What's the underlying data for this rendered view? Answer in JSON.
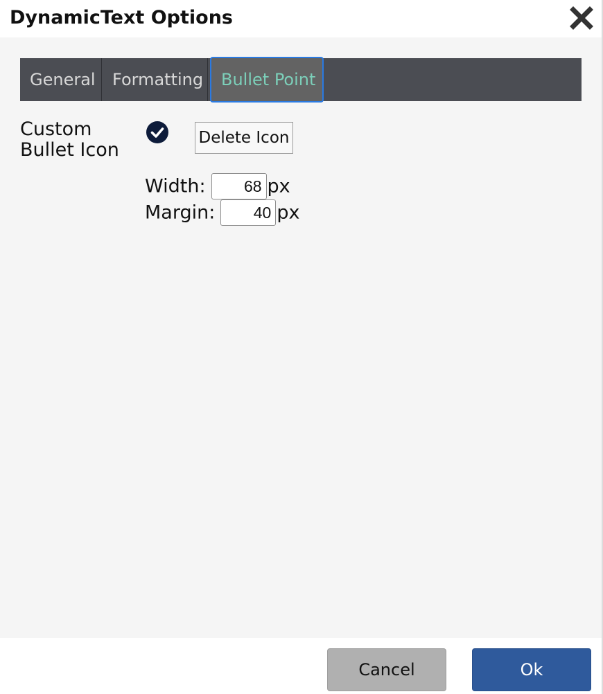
{
  "dialog": {
    "title": "DynamicText Options",
    "close_icon": "close-icon"
  },
  "tabs": [
    {
      "label": "General",
      "active": false
    },
    {
      "label": "Formatting",
      "active": false
    },
    {
      "label": "Bullet Point",
      "active": true
    }
  ],
  "bullet": {
    "label_line1": "Custom",
    "label_line2": "Bullet Icon",
    "check_icon": "check-circle-icon",
    "delete_label": "Delete Icon",
    "width_label": "Width:",
    "width_value": "68",
    "width_unit": "px",
    "margin_label": "Margin:",
    "margin_value": "40",
    "margin_unit": "px"
  },
  "footer": {
    "cancel_label": "Cancel",
    "ok_label": "Ok"
  },
  "colors": {
    "tabbar": "#4b4d53",
    "active_tab_text": "#7ccfb9",
    "active_tab_border": "#2a7ae2",
    "ok_button": "#2f5a9c",
    "cancel_button": "#b0b0b0",
    "check_icon": "#0d1b3a"
  }
}
